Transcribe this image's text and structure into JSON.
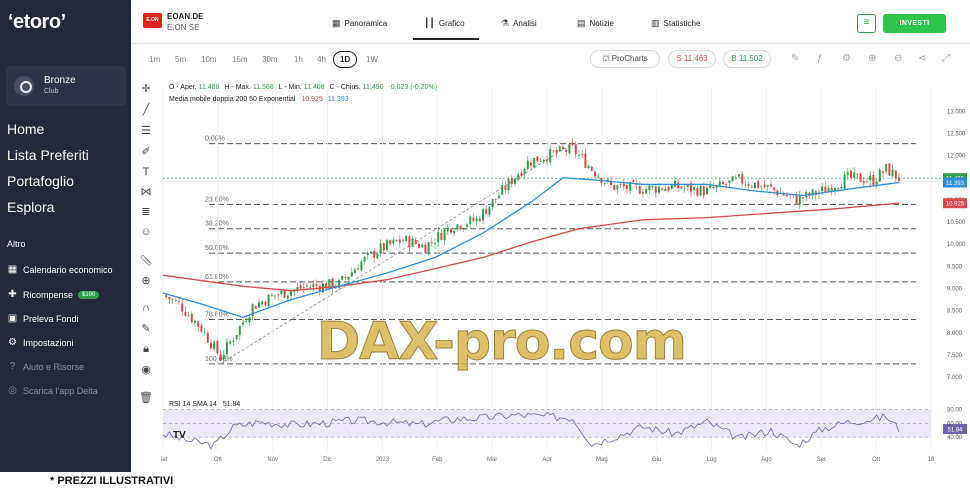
{
  "sidebar": {
    "logo": "‘etoro’",
    "club": {
      "name": "Bronze",
      "sub": "Club"
    },
    "nav": [
      "Home",
      "Lista Preferiti",
      "Portafoglio",
      "Esplora"
    ],
    "section": "Altro",
    "items": [
      {
        "label": "Calendario economico",
        "icon": "calendar-icon"
      },
      {
        "label": "Ricompense",
        "icon": "gift-icon",
        "badge": "$100"
      },
      {
        "label": "Preleva Fondi",
        "icon": "withdraw-icon"
      },
      {
        "label": "Impostazioni",
        "icon": "gear-icon"
      },
      {
        "label": "Aiuto e Risorse",
        "icon": "help-icon"
      },
      {
        "label": "Scarica l'app Delta",
        "icon": "download-icon"
      }
    ]
  },
  "header": {
    "logo_text": "E.ON",
    "symbol": "EOAN.DE",
    "name": "E.ON SE",
    "tabs": [
      "Panoramica",
      "Grafico",
      "Analisi",
      "Notizie",
      "Statistiche"
    ],
    "invest": "INVESTI"
  },
  "toolbar": {
    "timeframes": [
      "1m",
      "5m",
      "10m",
      "15m",
      "30m",
      "1h",
      "4h",
      "1D",
      "1W"
    ],
    "selected": "1D",
    "prochart": "ProCharts",
    "sell": "S 11.463",
    "buy": "B 11.502"
  },
  "legend": {
    "ohlc_prefix": "O - Aper.",
    "open": "11.488",
    "high_lbl": "H - Max.",
    "high": "11.568",
    "low_lbl": "L - Min.",
    "low": "11.408",
    "close_lbl": "C - Chius.",
    "close": "11.490",
    "change": "-0.023 (-0.20%)",
    "ma_lbl": "Media mobile doppia 200 50 Exponential",
    "ma1": "10.925",
    "ma2": "11.393",
    "rsi_lbl": "RSI 14 SMA 14",
    "rsi_val": "51.84"
  },
  "watermark": "DAX-pro.com",
  "footnote": "* PREZZI ILLUSTRATIVI",
  "chart_data": {
    "type": "candlestick",
    "y_ticks": [
      "13.000",
      "12.500",
      "12.000",
      "11.500",
      "11.000",
      "10.500",
      "10.000",
      "9.500",
      "9.000",
      "8.500",
      "8.000",
      "7.500",
      "7.000"
    ],
    "ylim": [
      6.8,
      13.3
    ],
    "x_ticks": [
      "Set",
      "Ott",
      "Nov",
      "Dic",
      "2023",
      "Feb",
      "Mar",
      "Apr",
      "Mag",
      "Giu",
      "Lug",
      "Ago",
      "Set",
      "Ott",
      "18"
    ],
    "fib_levels": [
      {
        "label": "0.00%",
        "value": 12.27
      },
      {
        "label": "23.60%",
        "value": 10.9
      },
      {
        "label": "38.20%",
        "value": 10.35
      },
      {
        "label": "50.00%",
        "value": 9.8
      },
      {
        "label": "61.80%",
        "value": 9.15
      },
      {
        "label": "78.60%",
        "value": 8.3
      },
      {
        "label": "100.00%",
        "value": 7.3
      }
    ],
    "price_points": [
      [
        0,
        8.85
      ],
      [
        5,
        8.65
      ],
      [
        12,
        8.1
      ],
      [
        18,
        7.45
      ],
      [
        22,
        7.9
      ],
      [
        28,
        8.6
      ],
      [
        35,
        8.85
      ],
      [
        45,
        9.05
      ],
      [
        55,
        9.1
      ],
      [
        62,
        9.6
      ],
      [
        68,
        9.9
      ],
      [
        75,
        10.1
      ],
      [
        82,
        9.95
      ],
      [
        90,
        10.4
      ],
      [
        98,
        10.55
      ],
      [
        106,
        11.2
      ],
      [
        114,
        11.85
      ],
      [
        122,
        12.05
      ],
      [
        128,
        12.15
      ],
      [
        134,
        11.7
      ],
      [
        140,
        11.3
      ],
      [
        150,
        11.25
      ],
      [
        160,
        11.3
      ],
      [
        170,
        11.2
      ],
      [
        180,
        11.45
      ],
      [
        190,
        11.25
      ],
      [
        198,
        11.0
      ],
      [
        206,
        11.2
      ],
      [
        214,
        11.5
      ],
      [
        222,
        11.45
      ],
      [
        226,
        11.7
      ],
      [
        230,
        11.49
      ]
    ],
    "series": [
      {
        "name": "EMA 200",
        "color": "#d84a4a",
        "value": 10.925,
        "points": [
          [
            0,
            9.3
          ],
          [
            10,
            9.2
          ],
          [
            25,
            9.05
          ],
          [
            40,
            8.95
          ],
          [
            55,
            9.05
          ],
          [
            70,
            9.2
          ],
          [
            85,
            9.45
          ],
          [
            100,
            9.7
          ],
          [
            115,
            10.05
          ],
          [
            130,
            10.35
          ],
          [
            150,
            10.55
          ],
          [
            170,
            10.6
          ],
          [
            190,
            10.7
          ],
          [
            210,
            10.8
          ],
          [
            230,
            10.925
          ]
        ]
      },
      {
        "name": "EMA 50",
        "color": "#2d8fd6",
        "value": 11.393,
        "points": [
          [
            0,
            8.9
          ],
          [
            12,
            8.65
          ],
          [
            25,
            8.35
          ],
          [
            40,
            8.75
          ],
          [
            55,
            9.05
          ],
          [
            70,
            9.35
          ],
          [
            85,
            9.7
          ],
          [
            100,
            10.25
          ],
          [
            115,
            10.95
          ],
          [
            125,
            11.5
          ],
          [
            135,
            11.45
          ],
          [
            150,
            11.35
          ],
          [
            170,
            11.35
          ],
          [
            185,
            11.2
          ],
          [
            200,
            11.1
          ],
          [
            215,
            11.25
          ],
          [
            230,
            11.393
          ]
        ]
      }
    ],
    "rsi": {
      "y_ticks": [
        "80.00",
        "60.00",
        "40.00"
      ],
      "ylim": [
        20,
        85
      ],
      "value": 51.84,
      "points": [
        [
          0,
          45
        ],
        [
          8,
          35
        ],
        [
          16,
          28
        ],
        [
          22,
          55
        ],
        [
          30,
          62
        ],
        [
          40,
          58
        ],
        [
          50,
          60
        ],
        [
          60,
          64
        ],
        [
          70,
          62
        ],
        [
          80,
          58
        ],
        [
          90,
          66
        ],
        [
          100,
          68
        ],
        [
          110,
          72
        ],
        [
          120,
          70
        ],
        [
          128,
          68
        ],
        [
          134,
          30
        ],
        [
          142,
          42
        ],
        [
          150,
          55
        ],
        [
          160,
          45
        ],
        [
          170,
          62
        ],
        [
          180,
          38
        ],
        [
          190,
          50
        ],
        [
          198,
          28
        ],
        [
          206,
          52
        ],
        [
          214,
          62
        ],
        [
          222,
          66
        ],
        [
          226,
          70
        ],
        [
          230,
          51.84
        ]
      ]
    },
    "price_labels": [
      {
        "value": "11.490",
        "color": "#2e9e4a"
      },
      {
        "value": "11.393",
        "color": "#2d8fd6"
      },
      {
        "value": "10.925",
        "color": "#d84a4a"
      }
    ]
  }
}
